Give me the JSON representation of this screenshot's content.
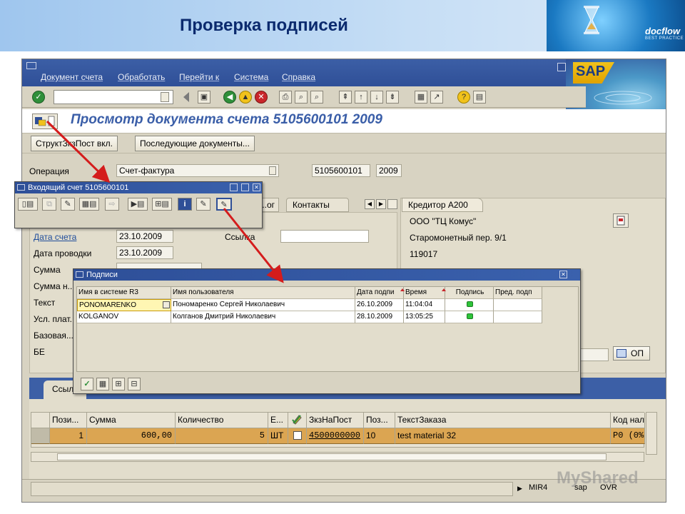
{
  "slide": {
    "title": "Проверка подписей",
    "logo_text": "docflow",
    "logo_sub": "BEST PRACTICE"
  },
  "sap": {
    "menu": [
      "Документ счета",
      "Обработать",
      "Перейти к",
      "Система",
      "Справка"
    ],
    "logo": "SAP",
    "doc_title": "Просмотр документа счета 5105600101 2009",
    "app_buttons": [
      "СтруктЗкзПост вкл.",
      "Последующие документы..."
    ],
    "operation_label": "Операция",
    "operation_value": "Счет-фактура",
    "doc_number": "5105600101",
    "doc_year": "2009",
    "tabs": [
      "...ог",
      "Контакты"
    ],
    "fields": {
      "invoice_date_label": "Дата счета",
      "invoice_date": "23.10.2009",
      "posting_date_label": "Дата проводки",
      "posting_date": "23.10.2009",
      "amount_label": "Сумма",
      "tax_amount_label": "Сумма н...",
      "text_label": "Текст",
      "payment_terms_label": "Усл. плат...",
      "base_date_label": "Базовая...",
      "be_label": "БЕ",
      "reference_label": "Ссылка",
      "op_button": "ОП"
    },
    "vendor": {
      "tab_label": "Кредитор А200",
      "name": "ООО \"ТЦ Комус\"",
      "street": "Старомонетный пер. 9/1",
      "zip": "119017"
    },
    "bottom_tab": "Ссыл...",
    "status": {
      "tcode": "MIR4",
      "system": "sap",
      "mode": "OVR"
    }
  },
  "incoming_popup": {
    "title": "Входящий счет 5105600101"
  },
  "signatures_popup": {
    "title": "Подписи",
    "columns": [
      "Имя в системе R3",
      "Имя пользователя",
      "Дата подпи",
      "Время",
      "Подпись",
      "Пред. подп"
    ],
    "rows": [
      {
        "login": "PONOMARENKO",
        "name": "Пономаренко Сергей Николаевич",
        "date": "26.10.2009",
        "time": "11:04:04",
        "signed": true
      },
      {
        "login": "KOLGANOV",
        "name": "Колганов Дмитрий Николаевич",
        "date": "28.10.2009",
        "time": "13:05:25",
        "signed": true
      }
    ]
  },
  "items_table": {
    "columns": [
      "Пози...",
      "Сумма",
      "Количество",
      "Е...",
      "",
      "ЗкзНаПост",
      "Поз...",
      "ТекстЗаказа",
      "Код нал"
    ],
    "rows": [
      {
        "position": "1",
        "amount": "600,00",
        "quantity": "5",
        "unit": "ШТ",
        "po_number": "4500000000",
        "po_item": "10",
        "po_text": "test material 32",
        "tax_code": "P0 (0%"
      }
    ]
  },
  "colors": {
    "sap_blue": "#2f4f97",
    "sap_bg": "#d8d3c2",
    "row_highlight": "#dba552",
    "arrow_red": "#d41c1c",
    "lamp_green": "#2ec43a"
  },
  "watermark": "MyShared"
}
